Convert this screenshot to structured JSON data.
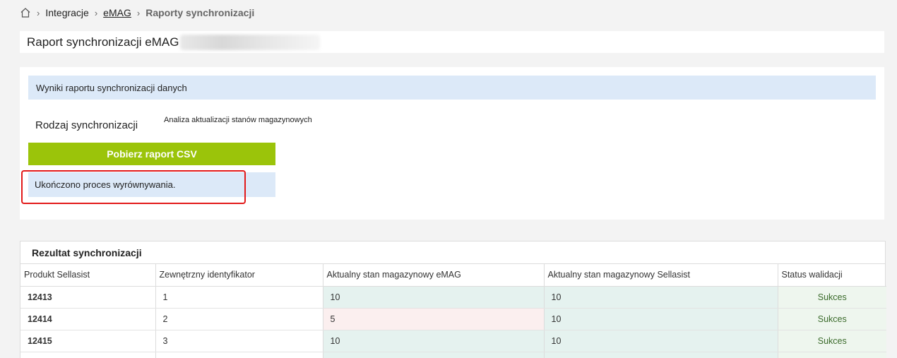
{
  "breadcrumb": {
    "home_icon": "home-icon",
    "items": [
      "Integracje",
      "eMAG",
      "Raporty synchronizacji"
    ]
  },
  "title": "Raport synchronizacji eMAG",
  "panel": {
    "header": "Wyniki raportu synchronizacji danych",
    "sync_type_label": "Rodzaj synchronizacji",
    "sync_type_value": "Analiza aktualizacji stanów magazynowych",
    "csv_button": "Pobierz raport CSV",
    "status_message": "Ukończono proces wyrównywania."
  },
  "result": {
    "title": "Rezultat synchronizacji",
    "columns": [
      "Produkt Sellasist",
      "Zewnętrzny identyfikator",
      "Aktualny stan magazynowy eMAG",
      "Aktualny stan magazynowy Sellasist",
      "Status walidacji"
    ],
    "rows": [
      {
        "product": "12413",
        "external_id": "1",
        "emag_stock": "10",
        "sellasist_stock": "10",
        "status": "Sukces"
      },
      {
        "product": "12414",
        "external_id": "2",
        "emag_stock": "5",
        "sellasist_stock": "10",
        "status": "Sukces"
      },
      {
        "product": "12415",
        "external_id": "3",
        "emag_stock": "10",
        "sellasist_stock": "10",
        "status": "Sukces"
      },
      {
        "product": "",
        "external_id": "",
        "emag_stock": "",
        "sellasist_stock": "",
        "status": ""
      }
    ]
  },
  "colors": {
    "accent_green": "#9bc40a",
    "header_blue": "#dce9f8",
    "highlight_red": "#e21a1a"
  }
}
